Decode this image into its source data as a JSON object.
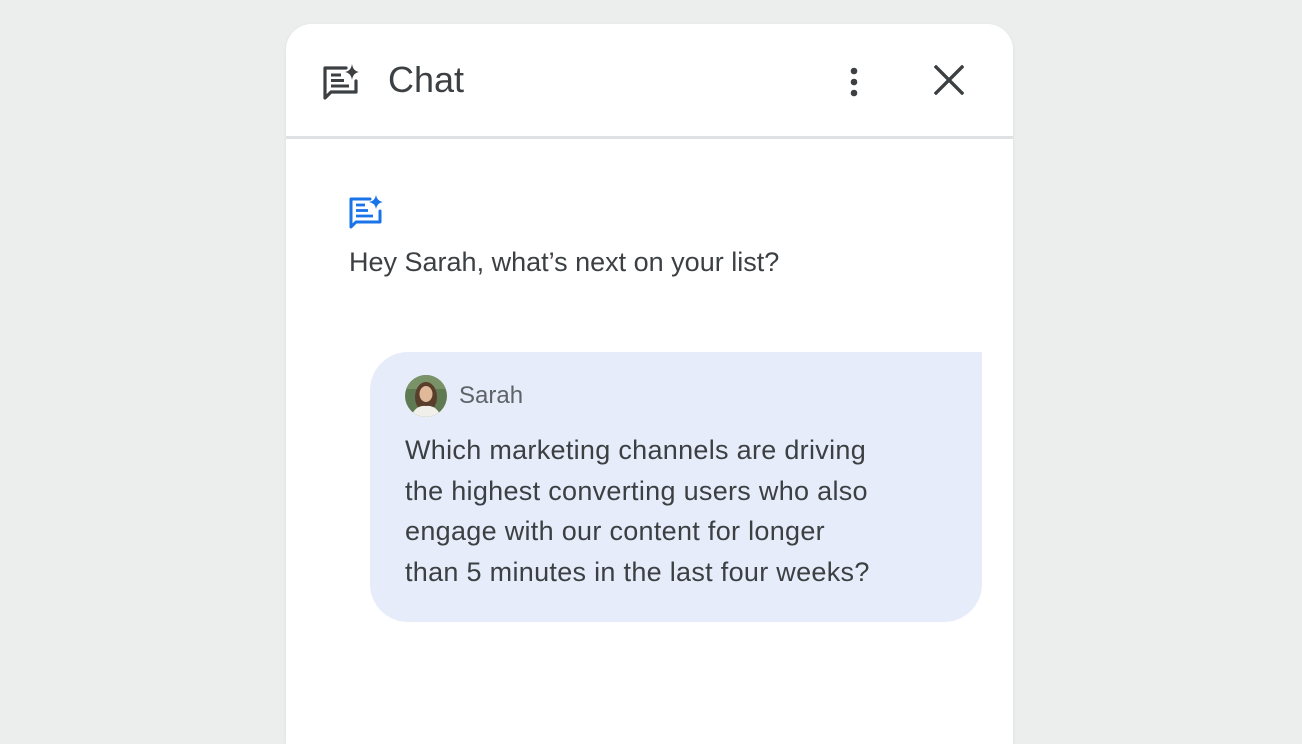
{
  "header": {
    "title": "Chat",
    "icon": "chat-spark-icon",
    "more_icon": "more-vert-icon",
    "close_icon": "close-icon"
  },
  "assistant": {
    "icon": "chat-spark-icon",
    "greeting": "Hey Sarah, what’s next on your list?"
  },
  "user_message": {
    "sender": "Sarah",
    "avatar": "avatar",
    "lines": [
      "Which marketing channels are driving",
      "the highest converting users who also",
      "engage with our content for longer",
      "than 5 minutes in the last four weeks?"
    ]
  },
  "colors": {
    "background": "#eceded",
    "panel": "#ffffff",
    "bubble": "#e6ecf9",
    "text": "#3c4043",
    "accent": "#1a73e8"
  }
}
